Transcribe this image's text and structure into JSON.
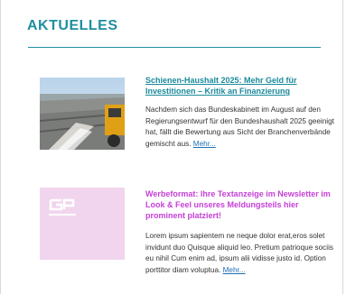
{
  "section": {
    "title": "AKTUELLES"
  },
  "articles": [
    {
      "title": "Schienen-Haushalt 2025: Mehr Geld für Investitionen – Kritik an Finanzierung",
      "text": "Nachdem sich das Bundeskabinett im August auf den Regierungsentwurf für den Bundeshaushalt 2025 geeinigt hat, fällt die Bewertung aus Sicht der Branchenverbände gemischt aus.",
      "more": "Mehr..."
    },
    {
      "title": "Werbeformat: Ihre Textanzeige im Newsletter im Look & Feel unseres Meldungsteils hier prominent platziert!",
      "text": "Lorem ipsum sapientem ne neque dolor erat,eros solet invidunt duo Quisque aliquid leo. Pretium patrioque sociis eu nihil Cum enim ad, ipsum alii vidisse justo id. Option porttitor diam voluptua.",
      "more": "Mehr..."
    }
  ],
  "colors": {
    "accent": "#1f8fa0",
    "ad_title": "#c53fd6",
    "ad_bg": "#f1d5ee",
    "link": "#1f6fb5"
  }
}
